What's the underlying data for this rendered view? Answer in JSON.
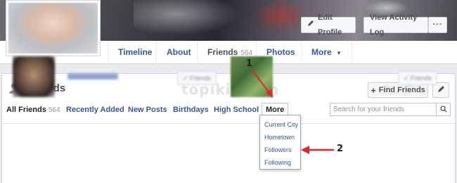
{
  "header": {
    "edit_profile_label": "Edit Profile",
    "activity_log_label": "View Activity Log",
    "more_dots_label": "···"
  },
  "nav": {
    "timeline": "Timeline",
    "about": "About",
    "friends": "Friends",
    "friends_count": "564",
    "photos": "Photos",
    "more": "More"
  },
  "friends_panel": {
    "title": "Friends",
    "watermark": "topikit.com",
    "find_friends_label": "Find Friends",
    "tabs": {
      "all": "All Friends",
      "all_count": "564",
      "recently_added": "Recently Added",
      "new_posts": "New Posts",
      "birthdays": "Birthdays",
      "high_school": "High School",
      "more": "More"
    },
    "search": {
      "placeholder": "Search for your friends"
    },
    "friend_button_label": "✓ Friends"
  },
  "more_dropdown": {
    "items": [
      "Current City",
      "Hometown",
      "Followers",
      "Following"
    ]
  },
  "annotations": {
    "one": "1",
    "two": "2"
  },
  "colors": {
    "link": "#365899",
    "arrow": "#e8232c",
    "panel_bg": "#ffffff",
    "page_bg": "#e9ebee"
  }
}
